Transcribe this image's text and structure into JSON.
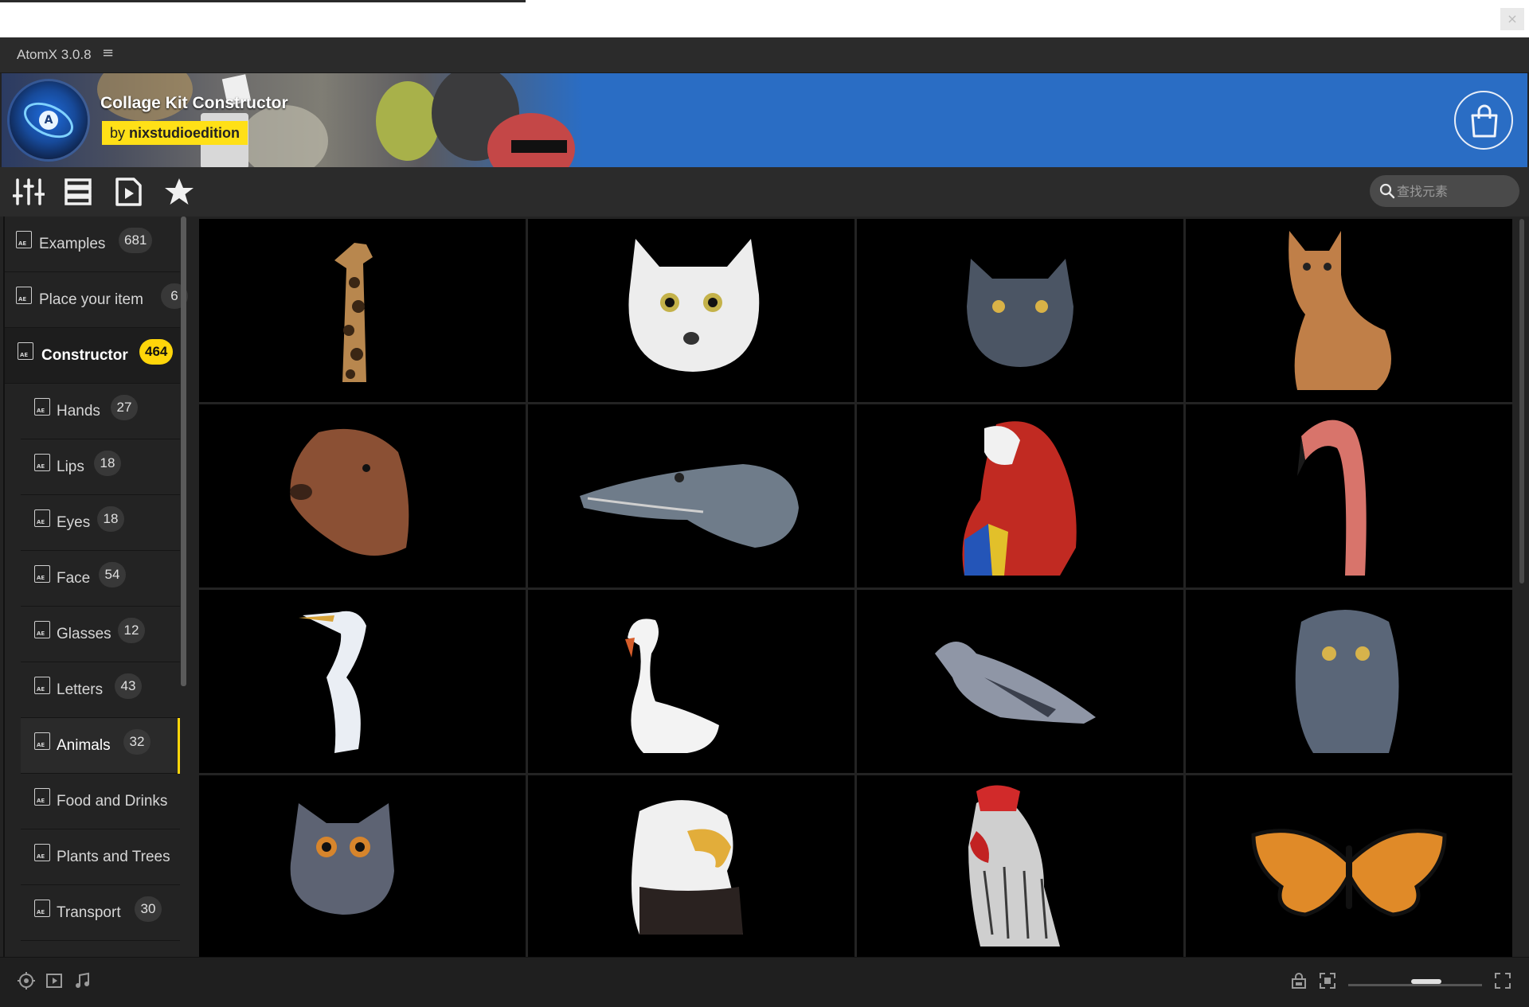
{
  "app": {
    "title": "AtomX 3.0.8",
    "menu_icon": "hamburger-icon",
    "close_glyph": "×"
  },
  "banner": {
    "kit_title": "Collage Kit Constructor",
    "author_prefix": "by",
    "author_name": "nixstudioedition",
    "logo_letter": "A",
    "shop_icon": "shopping-bag-icon"
  },
  "toolbar": {
    "tools": [
      "sliders-icon",
      "list-icon",
      "preview-icon",
      "favorites-star-icon"
    ],
    "search_placeholder": "查找元素"
  },
  "sidebar": {
    "categories": [
      {
        "label": "Examples",
        "count": "681"
      },
      {
        "label": "Place your item",
        "count": "6"
      },
      {
        "label": "Constructor",
        "count": "464"
      }
    ],
    "subcategories": [
      {
        "label": "Hands",
        "count": "27"
      },
      {
        "label": "Lips",
        "count": "18"
      },
      {
        "label": "Eyes",
        "count": "18"
      },
      {
        "label": "Face",
        "count": "54"
      },
      {
        "label": "Glasses",
        "count": "12"
      },
      {
        "label": "Letters",
        "count": "43"
      },
      {
        "label": "Animals",
        "count": "32"
      },
      {
        "label": "Food and Drinks",
        "count": ""
      },
      {
        "label": "Plants and Trees",
        "count": ""
      },
      {
        "label": "Transport",
        "count": "30"
      }
    ],
    "active": "Animals"
  },
  "grid": {
    "items": [
      "giraffe",
      "white-cat-head",
      "gray-cat-head",
      "tabby-kitten",
      "dog-head",
      "alligator-head",
      "macaw-parrot",
      "flamingo",
      "egret",
      "swan",
      "pigeon",
      "owlet",
      "eagle-owl",
      "bald-eagle",
      "rooster",
      "monarch-butterfly"
    ]
  },
  "statusbar": {
    "left_icons": [
      "compass-icon",
      "video-icon",
      "music-note-icon"
    ],
    "right_icons": [
      "lock-icon",
      "fit-frame-icon",
      "fullscreen-icon"
    ],
    "zoom_level": 0.5
  },
  "colors": {
    "accent": "#ffd60a",
    "banner": "#2a6dc4",
    "panel": "#232323"
  }
}
